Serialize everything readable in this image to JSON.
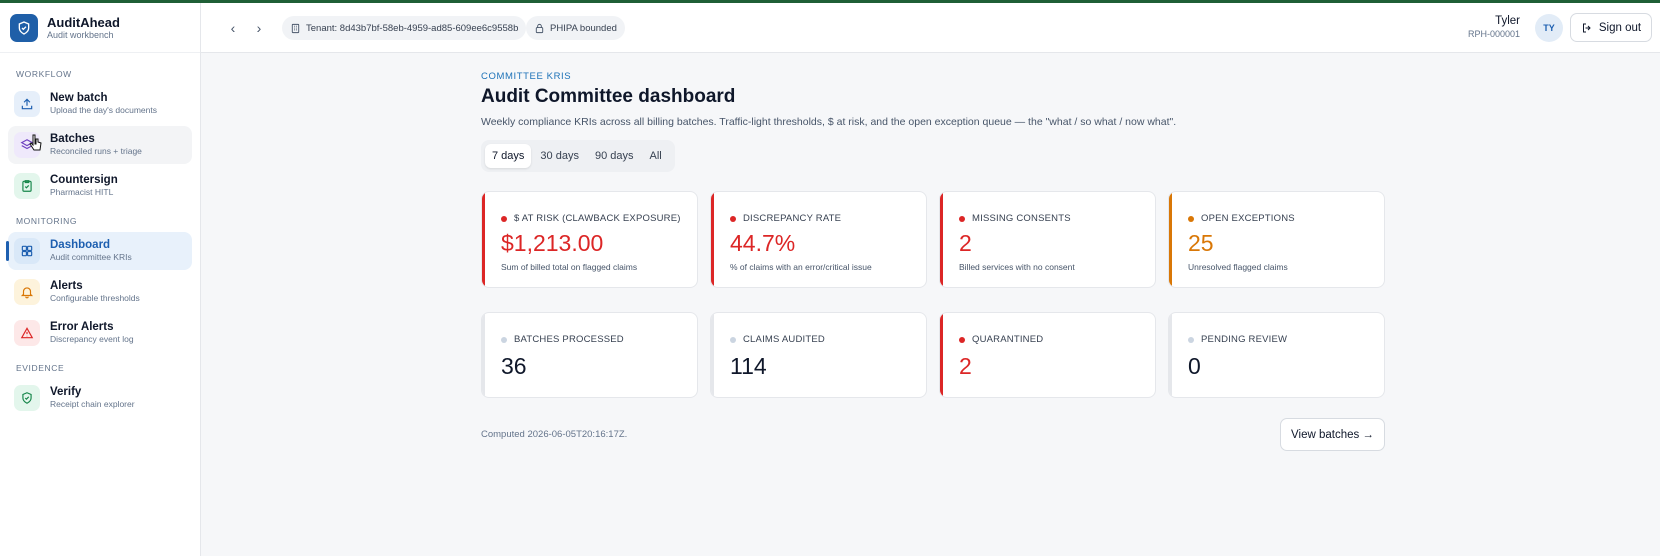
{
  "app": {
    "name": "AuditAhead",
    "subtitle": "Audit workbench"
  },
  "sidebar": {
    "sections": [
      {
        "label": "WORKFLOW"
      },
      {
        "label": "MONITORING"
      },
      {
        "label": "EVIDENCE"
      }
    ],
    "items": [
      {
        "title": "New batch",
        "sub": "Upload the day's documents",
        "icon": "upload-icon"
      },
      {
        "title": "Batches",
        "sub": "Reconciled runs + triage",
        "icon": "stack-icon"
      },
      {
        "title": "Countersign",
        "sub": "Pharmacist HITL",
        "icon": "clipboard-check-icon"
      },
      {
        "title": "Dashboard",
        "sub": "Audit committee KRIs",
        "icon": "dashboard-grid-icon"
      },
      {
        "title": "Alerts",
        "sub": "Configurable thresholds",
        "icon": "bell-icon"
      },
      {
        "title": "Error Alerts",
        "sub": "Discrepancy event log",
        "icon": "warning-triangle-icon"
      },
      {
        "title": "Verify",
        "sub": "Receipt chain explorer",
        "icon": "shield-check-icon"
      }
    ]
  },
  "header": {
    "tenant": "Tenant: 8d43b7bf-58eb-4959-ad85-609ee6c9558b",
    "privacy": "PHIPA bounded",
    "user_name": "Tyler",
    "user_id": "RPH-000001",
    "avatar_initials": "TY",
    "signout_label": "Sign out"
  },
  "main": {
    "eyebrow": "COMMITTEE KRIS",
    "title": "Audit Committee dashboard",
    "description": "Weekly compliance KRIs across all billing batches. Traffic-light thresholds, $ at risk, and the open exception queue — the \"what / so what / now what\".",
    "ranges": [
      "7 days",
      "30 days",
      "90 days",
      "All"
    ],
    "selected_range": "7 days",
    "kpis": [
      {
        "label": "$ AT RISK (CLAWBACK EXPOSURE)",
        "value": "$1,213.00",
        "sub": "Sum of billed total on flagged claims",
        "color": "#dc2626"
      },
      {
        "label": "DISCREPANCY RATE",
        "value": "44.7%",
        "sub": "% of claims with an error/critical issue",
        "color": "#dc2626"
      },
      {
        "label": "MISSING CONSENTS",
        "value": "2",
        "sub": "Billed services with no consent",
        "color": "#dc2626"
      },
      {
        "label": "OPEN EXCEPTIONS",
        "value": "25",
        "sub": "Unresolved flagged claims",
        "color": "#d97706"
      }
    ],
    "counts": [
      {
        "label": "BATCHES PROCESSED",
        "value": "36",
        "color": "#cbd5e1",
        "value_color": "#0f172a"
      },
      {
        "label": "CLAIMS AUDITED",
        "value": "114",
        "color": "#cbd5e1",
        "value_color": "#0f172a"
      },
      {
        "label": "QUARANTINED",
        "value": "2",
        "color": "#dc2626",
        "value_color": "#dc2626"
      },
      {
        "label": "PENDING REVIEW",
        "value": "0",
        "color": "#cbd5e1",
        "value_color": "#0f172a"
      }
    ],
    "computed": "Computed 2026-06-05T20:16:17Z.",
    "view_batches_label": "View batches →"
  }
}
